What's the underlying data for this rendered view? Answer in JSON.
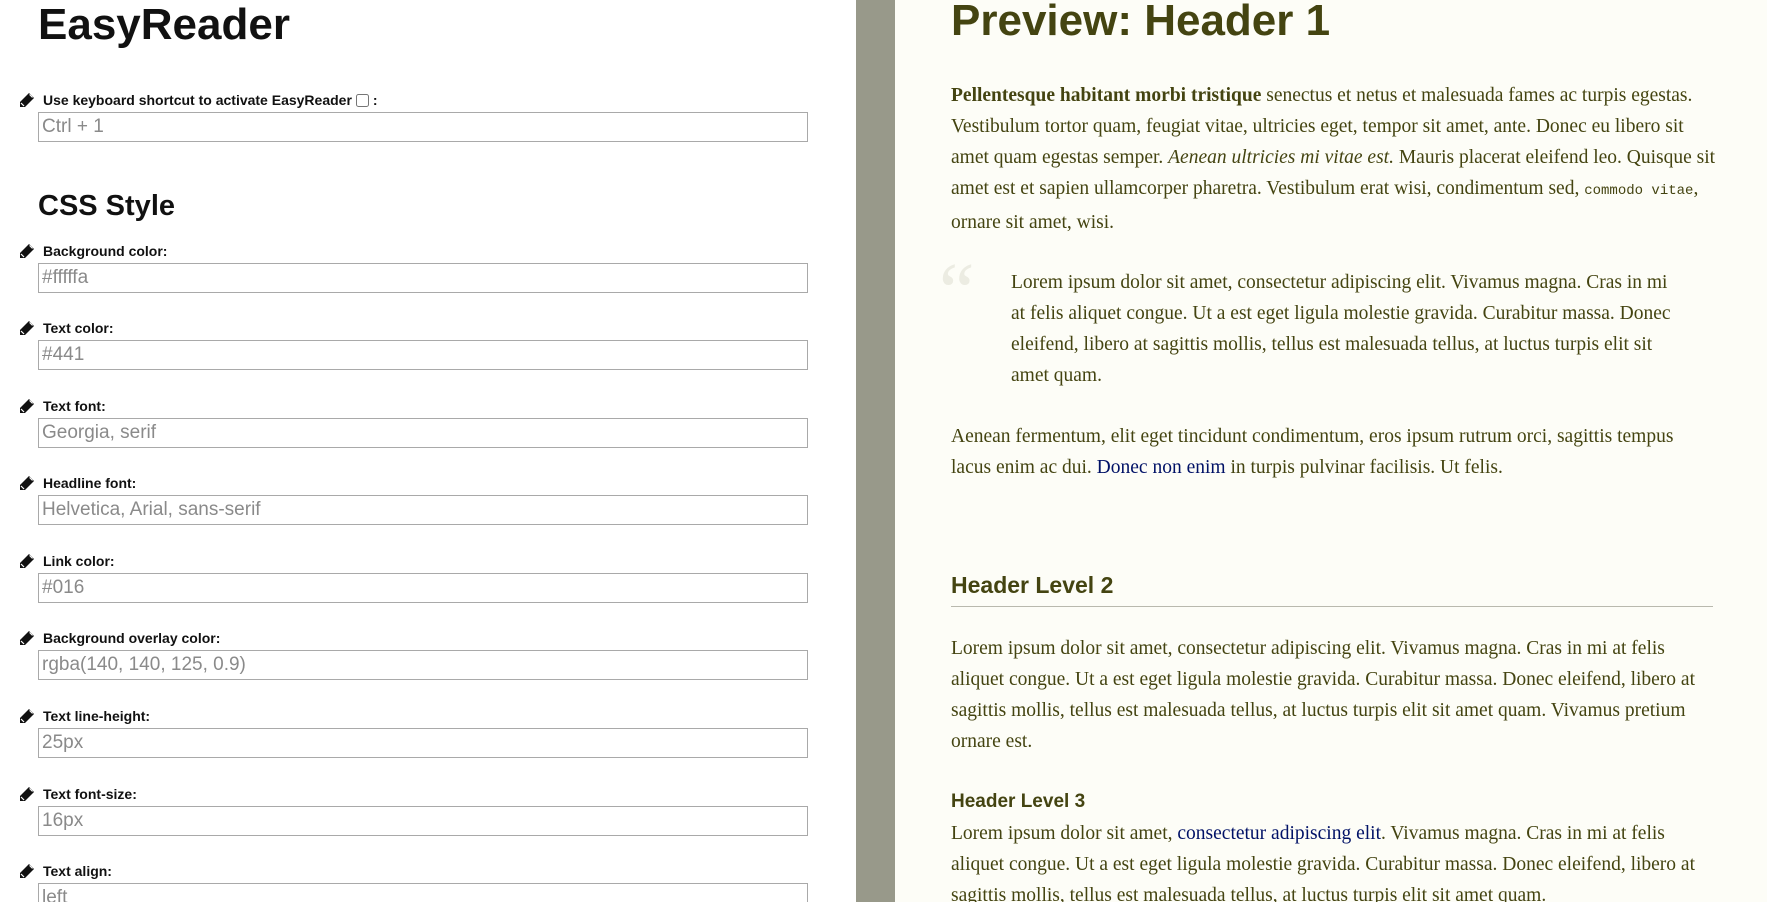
{
  "app_title": "EasyReader",
  "shortcut": {
    "label": "Use keyboard shortcut to activate EasyReader",
    "label_suffix": ":",
    "checkbox_checked": false,
    "placeholder": "Ctrl + 1"
  },
  "css_section_title": "CSS Style",
  "fields": {
    "background_color": {
      "label": "Background color:",
      "placeholder": "#fffffa"
    },
    "text_color": {
      "label": "Text color:",
      "placeholder": "#441"
    },
    "text_font": {
      "label": "Text font:",
      "placeholder": "Georgia, serif"
    },
    "headline_font": {
      "label": "Headline font:",
      "placeholder": "Helvetica, Arial, sans-serif"
    },
    "link_color": {
      "label": "Link color:",
      "placeholder": "#016"
    },
    "overlay_color": {
      "label": "Background overlay color:",
      "placeholder": "rgba(140, 140, 125, 0.9)"
    },
    "line_height": {
      "label": "Text line-height:",
      "placeholder": "25px"
    },
    "font_size": {
      "label": "Text font-size:",
      "placeholder": "16px"
    },
    "text_align": {
      "label": "Text align:",
      "placeholder": "left"
    }
  },
  "preview": {
    "h1": "Preview: Header 1",
    "p1": {
      "bold": "Pellentesque habitant morbi tristique",
      "text1": " senectus et netus et malesuada fames ac turpis egestas. Vestibulum tortor quam, feugiat vitae, ultricies eget, tempor sit amet, ante. Donec eu libero sit amet quam egestas semper. ",
      "italic": "Aenean ultricies mi vitae est.",
      "text2": " Mauris placerat eleifend leo. Quisque sit amet est et sapien ullamcorper pharetra. Vestibulum erat wisi, condimentum sed, ",
      "code": "commodo vitae",
      "text3": ", ornare sit amet, wisi."
    },
    "quote_mark": "“",
    "blockquote": "Lorem ipsum dolor sit amet, consectetur adipiscing elit. Vivamus magna. Cras in mi at felis aliquet congue. Ut a est eget ligula molestie gravida. Curabitur massa. Donec eleifend, libero at sagittis mollis, tellus est malesuada tellus, at luctus turpis elit sit amet quam.",
    "p2": {
      "text1": "Aenean fermentum, elit eget tincidunt condimentum, eros ipsum rutrum orci, sagittis tempus lacus enim ac dui. ",
      "link": "Donec non enim",
      "text2": " in turpis pulvinar facilisis. Ut felis."
    },
    "h2": "Header Level 2",
    "p3": "Lorem ipsum dolor sit amet, consectetur adipiscing elit. Vivamus magna. Cras in mi at felis aliquet congue. Ut a est eget ligula molestie gravida. Curabitur massa. Donec eleifend, libero at sagittis mollis, tellus est malesuada tellus, at luctus turpis elit sit amet quam. Vivamus pretium ornare est.",
    "h3": "Header Level 3",
    "p4": {
      "text1": "Lorem ipsum dolor sit amet, ",
      "link": "consectetur adipiscing elit",
      "text2": ". Vivamus magna. Cras in mi at felis aliquet congue. Ut a est eget ligula molestie gravida. Curabitur massa. Donec eleifend, libero at sagittis mollis, tellus est malesuada tellus, at luctus turpis elit sit amet quam."
    }
  },
  "colors": {
    "preview_background": "#fdfdf7",
    "preview_text": "#444411",
    "preview_link": "#001166",
    "divider": "#98998a"
  }
}
